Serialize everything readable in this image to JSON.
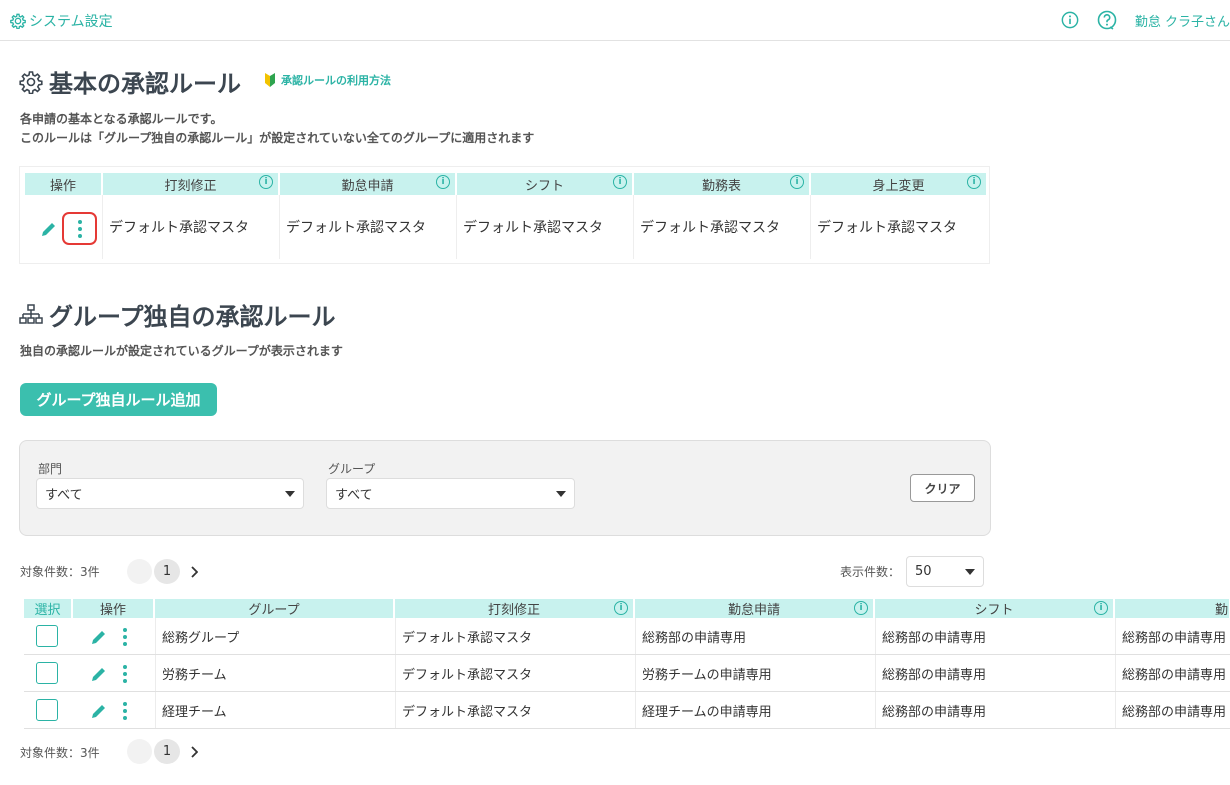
{
  "header": {
    "app_title": "システム設定",
    "user_name": "勤怠 クラ子さん"
  },
  "basic_rule": {
    "title": "基本の承認ルール",
    "help_link": "承認ルールの利用方法",
    "desc_line1": "各申請の基本となる承認ルールです。",
    "desc_line2": "このルールは「グループ独自の承認ルール」が設定されていない全てのグループに適用されます",
    "columns": [
      "操作",
      "打刻修正",
      "勤怠申請",
      "シフト",
      "勤務表",
      "身上変更"
    ],
    "values": [
      "デフォルト承認マスタ",
      "デフォルト承認マスタ",
      "デフォルト承認マスタ",
      "デフォルト承認マスタ",
      "デフォルト承認マスタ"
    ]
  },
  "group_rule": {
    "title": "グループ独自の承認ルール",
    "desc": "独自の承認ルールが設定されているグループが表示されます",
    "add_button": "グループ独自ルール追加",
    "filter": {
      "dept_label": "部門",
      "dept_value": "すべて",
      "group_label": "グループ",
      "group_value": "すべて",
      "clear_button": "クリア"
    },
    "count_text": "対象件数：3件",
    "page": "1",
    "per_page_label": "表示件数：",
    "per_page_value": "50",
    "columns": [
      "選択",
      "操作",
      "グループ",
      "打刻修正",
      "勤怠申請",
      "シフト",
      "勤"
    ],
    "rows": [
      {
        "group": "総務グループ",
        "stamp": "デフォルト承認マスタ",
        "attendance": "総務部の申請専用",
        "shift": "総務部の申請専用",
        "extra": "総務部の申請専用"
      },
      {
        "group": "労務チーム",
        "stamp": "デフォルト承認マスタ",
        "attendance": "労務チームの申請専用",
        "shift": "総務部の申請専用",
        "extra": "総務部の申請専用"
      },
      {
        "group": "経理チーム",
        "stamp": "デフォルト承認マスタ",
        "attendance": "経理チームの申請専用",
        "shift": "総務部の申請専用",
        "extra": "総務部の申請専用"
      }
    ]
  },
  "colors": {
    "accent": "#2bb3a5",
    "header_bg": "#c8f2ee",
    "highlight": "#e53935"
  }
}
